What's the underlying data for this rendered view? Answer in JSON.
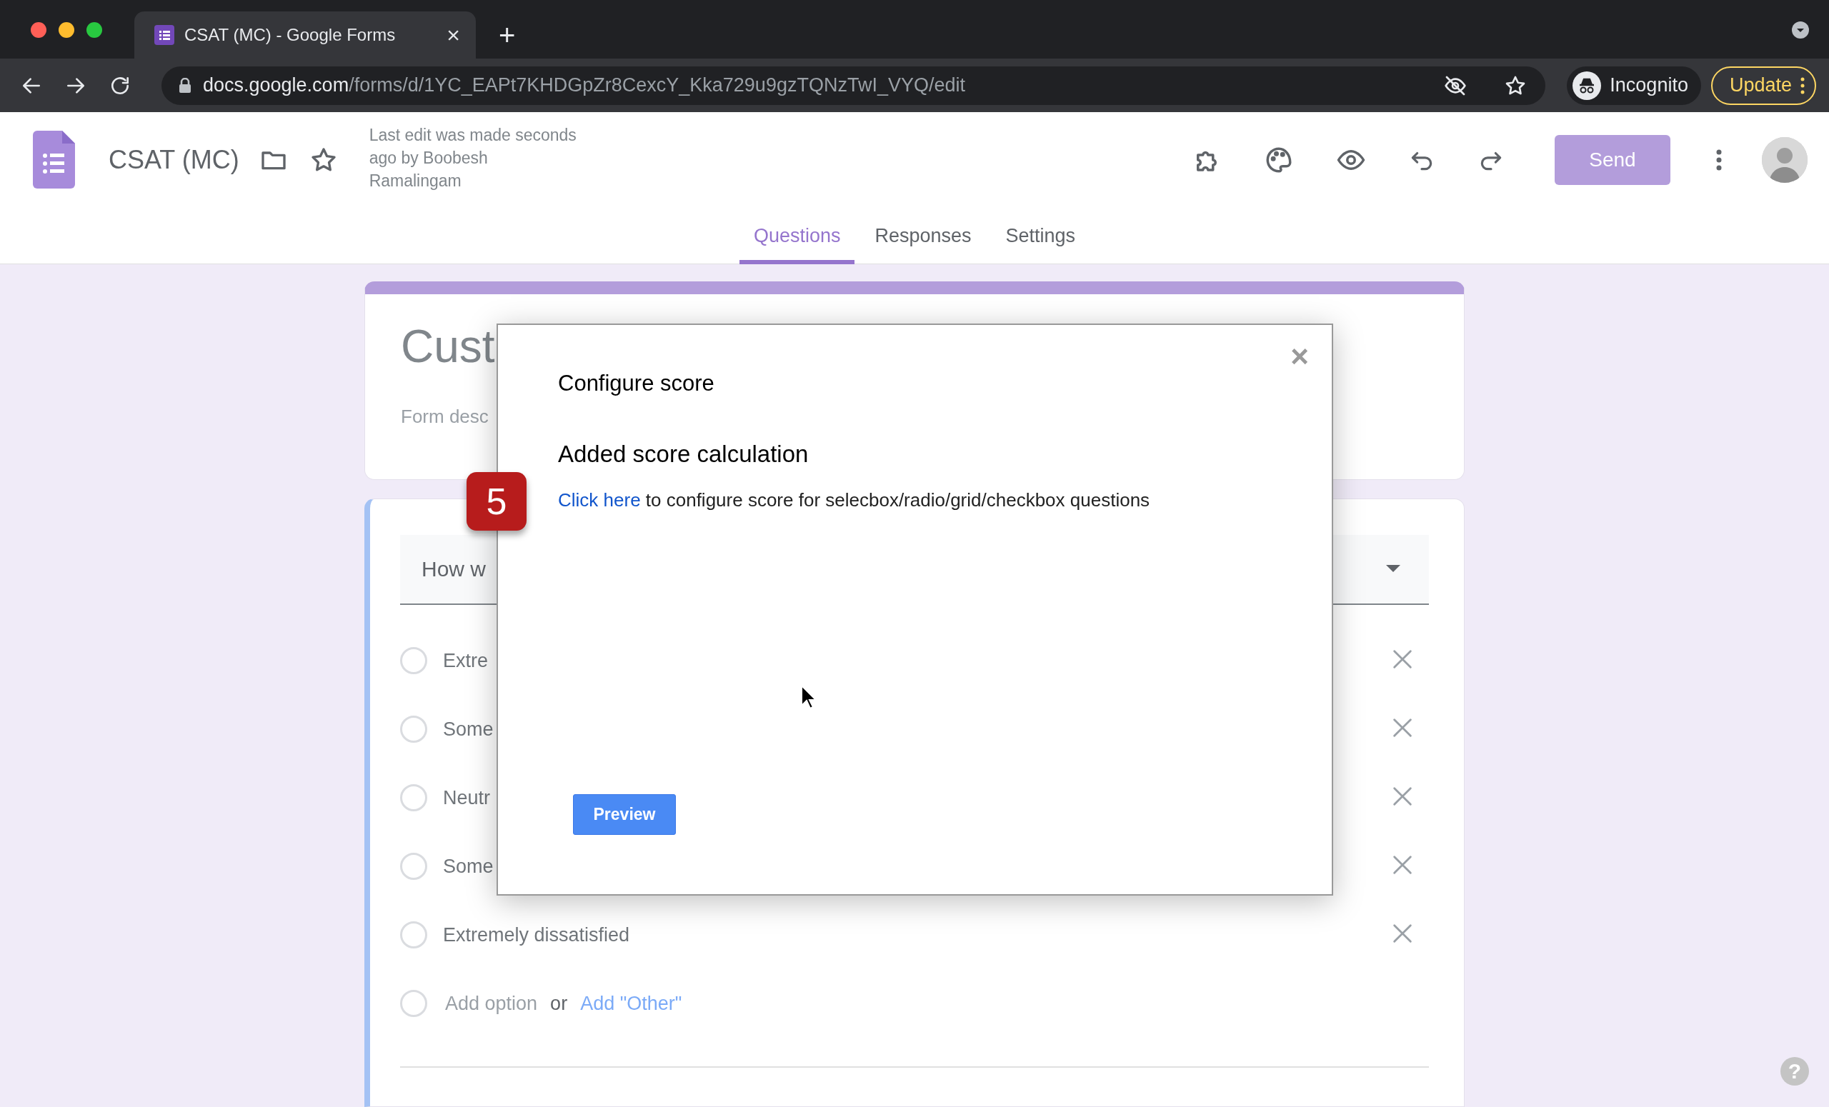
{
  "browser": {
    "tab": {
      "title": "CSAT (MC) - Google Forms",
      "close": "×"
    },
    "new_tab": "+",
    "address": {
      "host": "docs.google.com",
      "path": "/forms/d/1YC_EAPt7KHDGpZr8CexcY_Kka729u9gzTQNzTwI_VYQ/edit"
    },
    "profile": "Incognito",
    "update": "Update"
  },
  "header": {
    "title": "CSAT (MC)",
    "last_edit": [
      "Last edit was made seconds",
      "ago by Boobesh",
      "Ramalingam"
    ],
    "send": "Send"
  },
  "tabs": [
    {
      "label": "Questions",
      "selected": true
    },
    {
      "label": "Responses",
      "selected": false
    },
    {
      "label": "Settings",
      "selected": false
    }
  ],
  "form": {
    "title": "Cust",
    "description": "Form desc",
    "question": "How w",
    "options": [
      {
        "label": "Extre",
        "selected": false
      },
      {
        "label": "Some",
        "selected": false
      },
      {
        "label": "Neutr",
        "selected": false
      },
      {
        "label": "Some",
        "selected": false
      },
      {
        "label": "Extremely dissatisfied",
        "selected": false
      }
    ],
    "add_option": {
      "label": "Add option",
      "selected": false
    },
    "or": "or",
    "add_other": "Add \"Other\""
  },
  "dialog": {
    "title": "Configure score",
    "heading": "Added score calculation",
    "link": "Click here",
    "text": " to configure score for selecbox/radio/grid/checkbox questions",
    "button": "Preview",
    "close": "×"
  },
  "step_badge": "5",
  "help": "?"
}
